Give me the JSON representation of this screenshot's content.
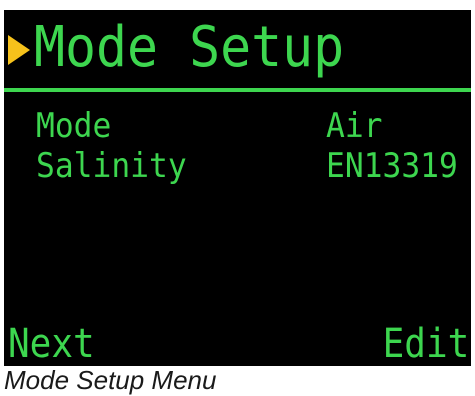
{
  "screen": {
    "title": "Mode Setup",
    "cursor_icon": "triangle-right-icon",
    "colors": {
      "text": "#3dd64f",
      "background": "#000000",
      "cursor": "#f6c21b"
    },
    "rows": [
      {
        "label": "Mode",
        "value": "Air"
      },
      {
        "label": "Salinity",
        "value": "EN13319"
      }
    ],
    "softkeys": {
      "left": "Next",
      "right": "Edit"
    }
  },
  "caption": "Mode Setup Menu"
}
